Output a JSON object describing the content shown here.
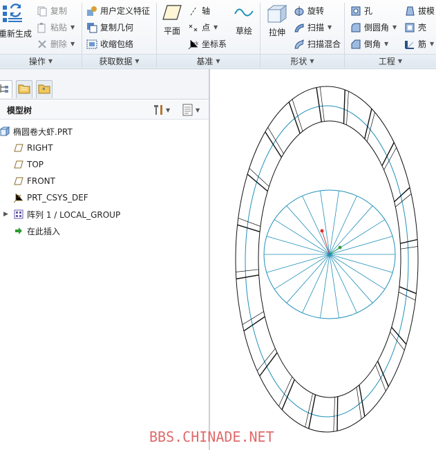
{
  "ribbon": {
    "operations": {
      "regenerate": "重新生成",
      "copy": "复制",
      "paste": "粘贴",
      "delete": "删除",
      "group": "操作"
    },
    "get_data": {
      "udf": "用户定义特征",
      "copy_geometry": "复制几何",
      "shrinkwrap": "收缩包络",
      "group": "获取数据"
    },
    "datum": {
      "plane": "平面",
      "axis": "轴",
      "point": "点",
      "csys": "坐标系",
      "sketch": "草绘",
      "group": "基准"
    },
    "shapes": {
      "extrude": "拉伸",
      "revolve": "旋转",
      "sweep": "扫描",
      "swept_blend": "扫描混合",
      "group": "形状"
    },
    "engineering": {
      "hole": "孔",
      "round": "倒圆角",
      "chamfer": "倒角",
      "draft": "拔模",
      "shell": "壳",
      "rib": "筋",
      "group": "工程"
    }
  },
  "model_tree": {
    "title": "模型树",
    "items": [
      {
        "label": "椭圆卷大虾.PRT",
        "icon": "part-icon"
      },
      {
        "label": "RIGHT",
        "icon": "datum-plane-icon"
      },
      {
        "label": "TOP",
        "icon": "datum-plane-icon"
      },
      {
        "label": "FRONT",
        "icon": "datum-plane-icon"
      },
      {
        "label": "PRT_CSYS_DEF",
        "icon": "csys-icon"
      },
      {
        "label": "阵列 1 / LOCAL_GROUP",
        "icon": "pattern-icon"
      },
      {
        "label": "在此插入",
        "icon": "insert-arrow-icon"
      }
    ]
  },
  "watermark": "BBS.CHINADE.NET",
  "colors": {
    "sketch_blue": "#1f8fb8",
    "edge_black": "#111111",
    "accent_green": "#2ea043",
    "ribbon_bg": "#eef2f6"
  }
}
